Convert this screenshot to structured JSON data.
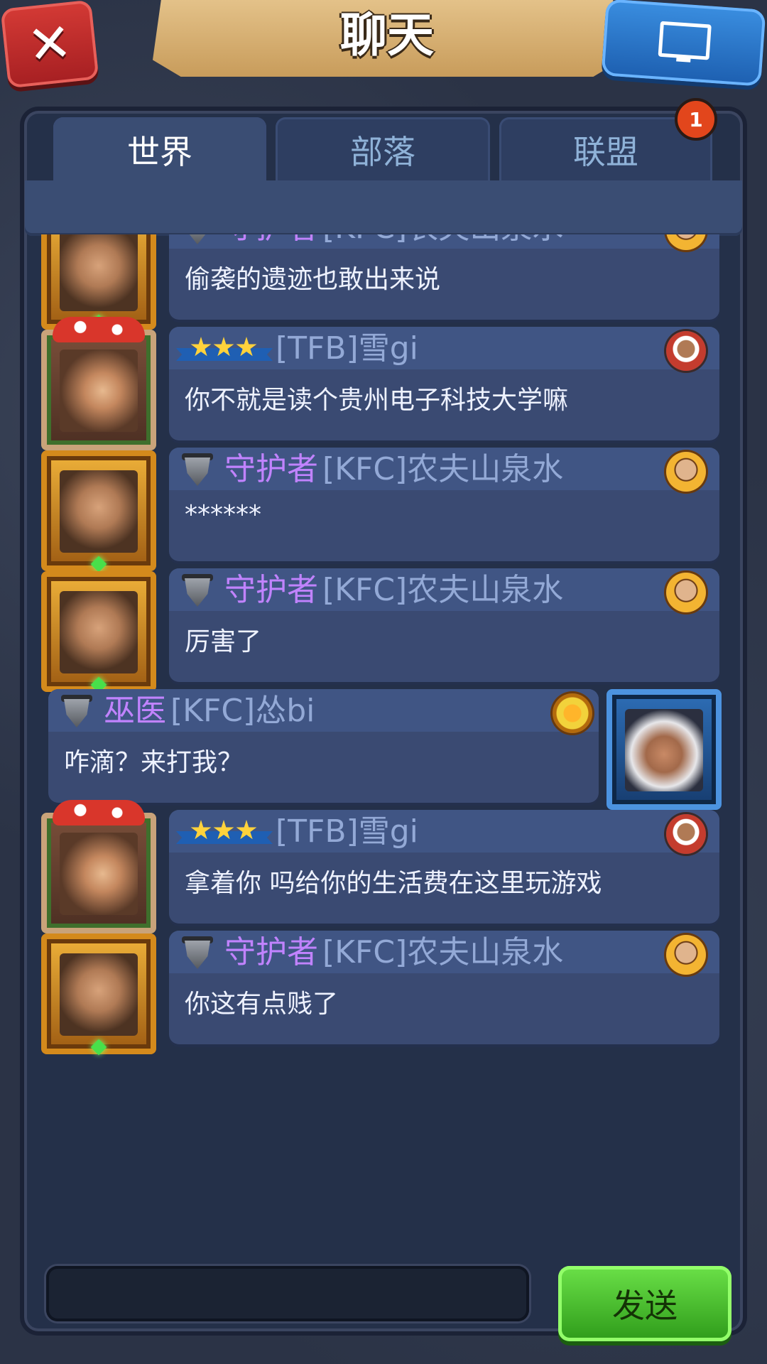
{
  "header": {
    "title": "聊天"
  },
  "tabs": [
    {
      "label": "世界",
      "active": true
    },
    {
      "label": "部落",
      "active": false
    },
    {
      "label": "联盟",
      "active": false
    }
  ],
  "notification_count": "1",
  "messages": [
    {
      "side": "left",
      "avatar": "gold",
      "badge_type": "rank",
      "role": "守护者",
      "name": "[KFC]农夫山泉水",
      "text": "偷袭的遗迹也敢出来说",
      "flag": "gold"
    },
    {
      "side": "left",
      "avatar": "mush",
      "badge_type": "stars",
      "role": "",
      "name": "[TFB]雪gi",
      "text": "你不就是读个贵州电子科技大学嘛",
      "flag": "red"
    },
    {
      "side": "left",
      "avatar": "gold",
      "badge_type": "rank",
      "role": "守护者",
      "name": "[KFC]农夫山泉水",
      "text": "******",
      "flag": "gold"
    },
    {
      "side": "left",
      "avatar": "gold",
      "badge_type": "rank",
      "role": "守护者",
      "name": "[KFC]农夫山泉水",
      "text": "厉害了",
      "flag": "gold"
    },
    {
      "side": "right",
      "avatar": "blue",
      "badge_type": "rank",
      "role": "巫医",
      "name": "[KFC]怂bi",
      "text": "咋滴？来打我？",
      "flag": "sun"
    },
    {
      "side": "left",
      "avatar": "mush",
      "badge_type": "stars",
      "role": "",
      "name": "[TFB]雪gi",
      "text": "拿着你 吗给你的生活费在这里玩游戏",
      "flag": "red"
    },
    {
      "side": "left",
      "avatar": "gold",
      "badge_type": "rank",
      "role": "守护者",
      "name": "[KFC]农夫山泉水",
      "text": "你这有点贱了",
      "flag": "gold"
    }
  ],
  "composer": {
    "input_value": "",
    "send_label": "发送"
  },
  "icons": {
    "close": "close-icon",
    "monitor": "monitor-icon",
    "rank": "rank-shield-icon",
    "stars": "stars-rank-icon",
    "flag": "guild-flag-icon"
  },
  "colors": {
    "role": "#c183ff",
    "guild_name": "#93a9d6",
    "send_button": "#3fbf24",
    "close_button": "#c62c2c",
    "monitor_button": "#2a7bd0",
    "badge": "#e2461c"
  }
}
